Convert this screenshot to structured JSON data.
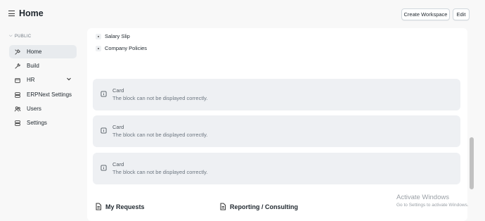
{
  "header": {
    "title": "Home",
    "create_workspace_label": "Create Workspace",
    "edit_label": "Edit"
  },
  "sidebar": {
    "section_label": "PUBLIC",
    "items": [
      {
        "label": "Home",
        "icon": "tool-icon",
        "active": true
      },
      {
        "label": "Build",
        "icon": "wrench-icon"
      },
      {
        "label": "HR",
        "icon": "folder-icon",
        "has_children": true
      },
      {
        "label": "ERPNext Settings",
        "icon": "server-icon"
      },
      {
        "label": "Users",
        "icon": "users-icon"
      },
      {
        "label": "Settings",
        "icon": "server-icon"
      }
    ]
  },
  "main": {
    "links": [
      "Salary Slip",
      "Company Policies"
    ],
    "cards": [
      {
        "title": "Card",
        "message": "The block can not be displayed correctly."
      },
      {
        "title": "Card",
        "message": "The block can not be displayed correctly."
      },
      {
        "title": "Card",
        "message": "The block can not be displayed correctly."
      }
    ],
    "sections": [
      {
        "title": "My Requests",
        "icon": "file-icon"
      },
      {
        "title": "Reporting / Consulting",
        "icon": "file-icon"
      }
    ]
  },
  "watermark": {
    "line1": "Activate Windows",
    "line2": "Go to Settings to activate Windows."
  }
}
